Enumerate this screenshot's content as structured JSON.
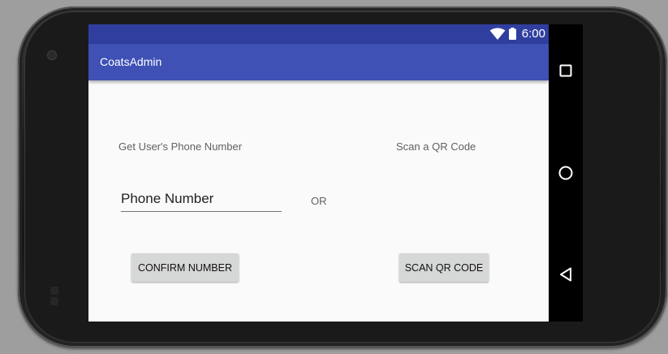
{
  "status_bar": {
    "time": "6:00",
    "icons": [
      "wifi-icon",
      "battery-icon"
    ],
    "color": "#303f9f"
  },
  "app_bar": {
    "title": "CoatsAdmin",
    "color": "#3f51b5"
  },
  "main": {
    "phone_label": "Get User's Phone Number",
    "qr_label": "Scan a QR Code",
    "phone_input": {
      "placeholder": "Phone Number",
      "value": ""
    },
    "or_label": "OR",
    "confirm_button": "CONFIRM NUMBER",
    "scan_button": "SCAN QR CODE"
  },
  "nav_bar": {
    "icons": [
      "recents-icon",
      "home-icon",
      "back-icon"
    ]
  }
}
